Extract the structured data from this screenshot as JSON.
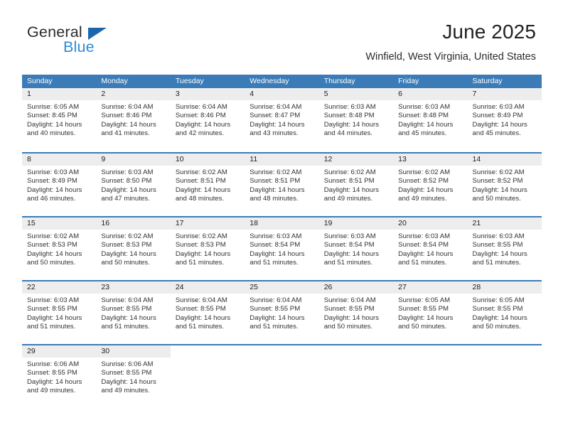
{
  "brand": {
    "name_part1": "General",
    "name_part2": "Blue",
    "triangle_color": "#1c66ae",
    "blue_color": "#2e8bd6"
  },
  "header": {
    "title": "June 2025",
    "subtitle": "Winfield, West Virginia, United States"
  },
  "theme": {
    "header_blue": "#3b7cb8",
    "day_band_gray": "#ededed",
    "text": "#333333"
  },
  "weekdays": [
    "Sunday",
    "Monday",
    "Tuesday",
    "Wednesday",
    "Thursday",
    "Friday",
    "Saturday"
  ],
  "weeks": [
    [
      {
        "day": "1",
        "sunrise": "Sunrise: 6:05 AM",
        "sunset": "Sunset: 8:45 PM",
        "daylight": "Daylight: 14 hours and 40 minutes."
      },
      {
        "day": "2",
        "sunrise": "Sunrise: 6:04 AM",
        "sunset": "Sunset: 8:46 PM",
        "daylight": "Daylight: 14 hours and 41 minutes."
      },
      {
        "day": "3",
        "sunrise": "Sunrise: 6:04 AM",
        "sunset": "Sunset: 8:46 PM",
        "daylight": "Daylight: 14 hours and 42 minutes."
      },
      {
        "day": "4",
        "sunrise": "Sunrise: 6:04 AM",
        "sunset": "Sunset: 8:47 PM",
        "daylight": "Daylight: 14 hours and 43 minutes."
      },
      {
        "day": "5",
        "sunrise": "Sunrise: 6:03 AM",
        "sunset": "Sunset: 8:48 PM",
        "daylight": "Daylight: 14 hours and 44 minutes."
      },
      {
        "day": "6",
        "sunrise": "Sunrise: 6:03 AM",
        "sunset": "Sunset: 8:48 PM",
        "daylight": "Daylight: 14 hours and 45 minutes."
      },
      {
        "day": "7",
        "sunrise": "Sunrise: 6:03 AM",
        "sunset": "Sunset: 8:49 PM",
        "daylight": "Daylight: 14 hours and 45 minutes."
      }
    ],
    [
      {
        "day": "8",
        "sunrise": "Sunrise: 6:03 AM",
        "sunset": "Sunset: 8:49 PM",
        "daylight": "Daylight: 14 hours and 46 minutes."
      },
      {
        "day": "9",
        "sunrise": "Sunrise: 6:03 AM",
        "sunset": "Sunset: 8:50 PM",
        "daylight": "Daylight: 14 hours and 47 minutes."
      },
      {
        "day": "10",
        "sunrise": "Sunrise: 6:02 AM",
        "sunset": "Sunset: 8:51 PM",
        "daylight": "Daylight: 14 hours and 48 minutes."
      },
      {
        "day": "11",
        "sunrise": "Sunrise: 6:02 AM",
        "sunset": "Sunset: 8:51 PM",
        "daylight": "Daylight: 14 hours and 48 minutes."
      },
      {
        "day": "12",
        "sunrise": "Sunrise: 6:02 AM",
        "sunset": "Sunset: 8:51 PM",
        "daylight": "Daylight: 14 hours and 49 minutes."
      },
      {
        "day": "13",
        "sunrise": "Sunrise: 6:02 AM",
        "sunset": "Sunset: 8:52 PM",
        "daylight": "Daylight: 14 hours and 49 minutes."
      },
      {
        "day": "14",
        "sunrise": "Sunrise: 6:02 AM",
        "sunset": "Sunset: 8:52 PM",
        "daylight": "Daylight: 14 hours and 50 minutes."
      }
    ],
    [
      {
        "day": "15",
        "sunrise": "Sunrise: 6:02 AM",
        "sunset": "Sunset: 8:53 PM",
        "daylight": "Daylight: 14 hours and 50 minutes."
      },
      {
        "day": "16",
        "sunrise": "Sunrise: 6:02 AM",
        "sunset": "Sunset: 8:53 PM",
        "daylight": "Daylight: 14 hours and 50 minutes."
      },
      {
        "day": "17",
        "sunrise": "Sunrise: 6:02 AM",
        "sunset": "Sunset: 8:53 PM",
        "daylight": "Daylight: 14 hours and 51 minutes."
      },
      {
        "day": "18",
        "sunrise": "Sunrise: 6:03 AM",
        "sunset": "Sunset: 8:54 PM",
        "daylight": "Daylight: 14 hours and 51 minutes."
      },
      {
        "day": "19",
        "sunrise": "Sunrise: 6:03 AM",
        "sunset": "Sunset: 8:54 PM",
        "daylight": "Daylight: 14 hours and 51 minutes."
      },
      {
        "day": "20",
        "sunrise": "Sunrise: 6:03 AM",
        "sunset": "Sunset: 8:54 PM",
        "daylight": "Daylight: 14 hours and 51 minutes."
      },
      {
        "day": "21",
        "sunrise": "Sunrise: 6:03 AM",
        "sunset": "Sunset: 8:55 PM",
        "daylight": "Daylight: 14 hours and 51 minutes."
      }
    ],
    [
      {
        "day": "22",
        "sunrise": "Sunrise: 6:03 AM",
        "sunset": "Sunset: 8:55 PM",
        "daylight": "Daylight: 14 hours and 51 minutes."
      },
      {
        "day": "23",
        "sunrise": "Sunrise: 6:04 AM",
        "sunset": "Sunset: 8:55 PM",
        "daylight": "Daylight: 14 hours and 51 minutes."
      },
      {
        "day": "24",
        "sunrise": "Sunrise: 6:04 AM",
        "sunset": "Sunset: 8:55 PM",
        "daylight": "Daylight: 14 hours and 51 minutes."
      },
      {
        "day": "25",
        "sunrise": "Sunrise: 6:04 AM",
        "sunset": "Sunset: 8:55 PM",
        "daylight": "Daylight: 14 hours and 51 minutes."
      },
      {
        "day": "26",
        "sunrise": "Sunrise: 6:04 AM",
        "sunset": "Sunset: 8:55 PM",
        "daylight": "Daylight: 14 hours and 50 minutes."
      },
      {
        "day": "27",
        "sunrise": "Sunrise: 6:05 AM",
        "sunset": "Sunset: 8:55 PM",
        "daylight": "Daylight: 14 hours and 50 minutes."
      },
      {
        "day": "28",
        "sunrise": "Sunrise: 6:05 AM",
        "sunset": "Sunset: 8:55 PM",
        "daylight": "Daylight: 14 hours and 50 minutes."
      }
    ],
    [
      {
        "day": "29",
        "sunrise": "Sunrise: 6:06 AM",
        "sunset": "Sunset: 8:55 PM",
        "daylight": "Daylight: 14 hours and 49 minutes."
      },
      {
        "day": "30",
        "sunrise": "Sunrise: 6:06 AM",
        "sunset": "Sunset: 8:55 PM",
        "daylight": "Daylight: 14 hours and 49 minutes."
      },
      {
        "day": "",
        "sunrise": "",
        "sunset": "",
        "daylight": ""
      },
      {
        "day": "",
        "sunrise": "",
        "sunset": "",
        "daylight": ""
      },
      {
        "day": "",
        "sunrise": "",
        "sunset": "",
        "daylight": ""
      },
      {
        "day": "",
        "sunrise": "",
        "sunset": "",
        "daylight": ""
      },
      {
        "day": "",
        "sunrise": "",
        "sunset": "",
        "daylight": ""
      }
    ]
  ]
}
